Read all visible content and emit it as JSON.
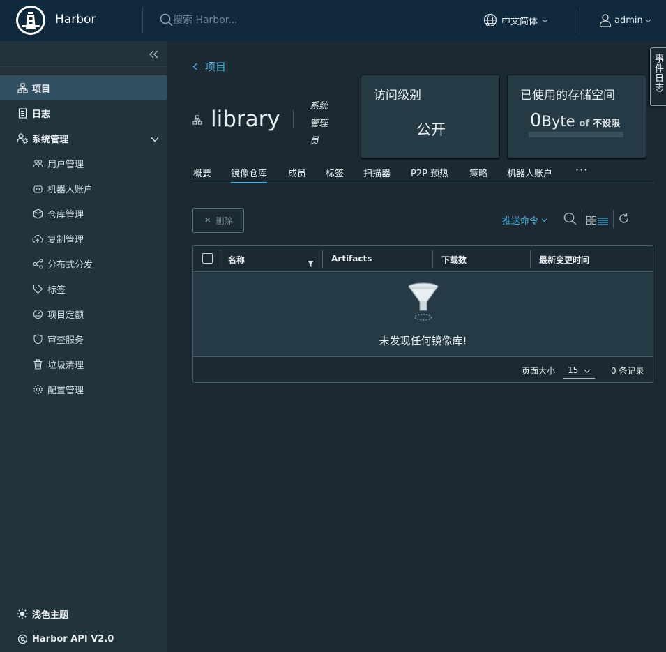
{
  "header": {
    "brand": "Harbor",
    "search_placeholder": "搜索 Harbor...",
    "language": "中文简体",
    "user": "admin"
  },
  "sidebar": {
    "items": [
      {
        "label": "项目",
        "icon": "projects-icon",
        "active": true
      },
      {
        "label": "日志",
        "icon": "logs-icon"
      },
      {
        "label": "系统管理",
        "icon": "admin-icon"
      }
    ],
    "sub_items": [
      {
        "label": "用户管理",
        "icon": "users-icon"
      },
      {
        "label": "机器人账户",
        "icon": "robot-icon"
      },
      {
        "label": "仓库管理",
        "icon": "registry-icon"
      },
      {
        "label": "复制管理",
        "icon": "cloud-icon"
      },
      {
        "label": "分布式分发",
        "icon": "share-icon"
      },
      {
        "label": "标签",
        "icon": "tag-icon"
      },
      {
        "label": "项目定额",
        "icon": "quota-icon"
      },
      {
        "label": "审查服务",
        "icon": "shield-icon"
      },
      {
        "label": "垃圾清理",
        "icon": "trash-icon"
      },
      {
        "label": "配置管理",
        "icon": "gear-icon"
      }
    ],
    "footer": {
      "theme": "浅色主题",
      "api": "Harbor API V2.0"
    }
  },
  "main": {
    "back_label": "项目",
    "project_name": "library",
    "role": "系统管理员",
    "access_card": {
      "title": "访问级别",
      "value": "公开"
    },
    "storage_card": {
      "title": "已使用的存储空间",
      "number": "0",
      "unit": "Byte",
      "of": "of",
      "limit": "不设限"
    },
    "tabs": [
      "概要",
      "镜像仓库",
      "成员",
      "标签",
      "扫描器",
      "P2P 预热",
      "策略",
      "机器人账户"
    ],
    "active_tab": "镜像仓库",
    "more": "···",
    "delete_label": "删除",
    "push_label": "推送命令",
    "grid": {
      "columns": [
        "名称",
        "Artifacts",
        "下载数",
        "最新变更时间"
      ],
      "empty_text": "未发现任何镜像库!",
      "page_size_label": "页面大小",
      "page_size": "15",
      "record_count": "0 条记录"
    },
    "event_log": "事件日志"
  },
  "colors": {
    "header_bg": "#0f2a3d",
    "sidebar_bg": "#21333b",
    "main_bg": "#1b2a32",
    "accent": "#4aaed9",
    "active_nav": "#324f61"
  }
}
